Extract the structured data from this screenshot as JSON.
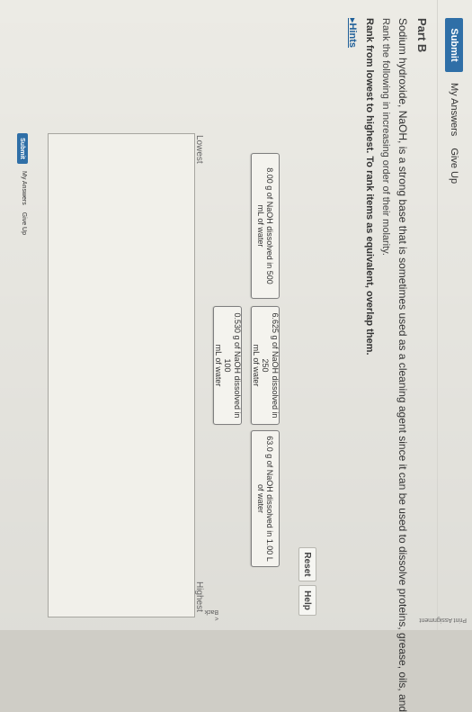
{
  "header": {
    "submit_label": "Submit",
    "my_answers": "My Answers",
    "give_up": "Give Up"
  },
  "part": {
    "title": "Part B"
  },
  "question": {
    "line1": "Sodium hydroxide, NaOH, is a strong base that is sometimes used as a cleaning agent since it can be used to dissolve proteins, grease, oils, and",
    "line2": "Rank the following in increasing order of their molarity.",
    "line3": "Rank from lowest to highest. To rank items as equivalent, overlap them.",
    "hints": "Hints"
  },
  "controls": {
    "reset": "Reset",
    "help": "Help"
  },
  "items": [
    {
      "line1": "8.00 g of NaOH dissolved in 500",
      "line2": "mL of water"
    },
    {
      "line1": "6.625 g of NaOH dissolved in 250",
      "line2": "mL of water"
    },
    {
      "line1": "63.0 g of NaOH dissolved in 1.00 L",
      "line2": "of water"
    },
    {
      "line1": "0.530 g of NaOH dissolved in 100",
      "line2": "mL of water"
    }
  ],
  "ranking": {
    "lowest": "Lowest",
    "highest": "Highest"
  },
  "footer": {
    "submit_label": "Submit",
    "my_answers": "My Answers",
    "give_up": "Give Up",
    "back": "< Back",
    "print": "Print Assignment"
  }
}
